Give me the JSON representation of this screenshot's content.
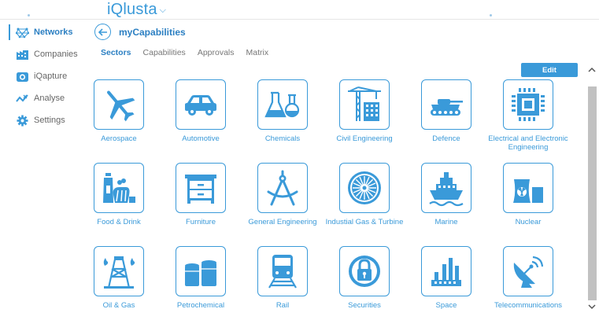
{
  "app": {
    "title": "iQlusta"
  },
  "sidebar": {
    "items": [
      {
        "label": "Networks",
        "icon": "network-icon",
        "active": true
      },
      {
        "label": "Companies",
        "icon": "companies-icon",
        "active": false
      },
      {
        "label": "iQapture",
        "icon": "camera-icon",
        "active": false
      },
      {
        "label": "Analyse",
        "icon": "analyse-icon",
        "active": false
      },
      {
        "label": "Settings",
        "icon": "gear-icon",
        "active": false
      }
    ]
  },
  "page": {
    "title": "myCapabilities",
    "tabs": [
      {
        "label": "Sectors",
        "active": true
      },
      {
        "label": "Capabilities",
        "active": false
      },
      {
        "label": "Approvals",
        "active": false
      },
      {
        "label": "Matrix",
        "active": false
      }
    ],
    "edit_label": "Edit"
  },
  "sectors": [
    {
      "label": "Aerospace",
      "icon": "airplane-icon"
    },
    {
      "label": "Automotive",
      "icon": "car-icon"
    },
    {
      "label": "Chemicals",
      "icon": "flask-icon"
    },
    {
      "label": "Civil Engineering",
      "icon": "crane-icon"
    },
    {
      "label": "Defence",
      "icon": "tank-icon"
    },
    {
      "label": "Electrical and Electronic Engineering",
      "icon": "microchip-icon"
    },
    {
      "label": "Food & Drink",
      "icon": "food-icon"
    },
    {
      "label": "Furniture",
      "icon": "drawers-icon"
    },
    {
      "label": "General Engineering",
      "icon": "compass-icon"
    },
    {
      "label": "Industial Gas & Turbine",
      "icon": "turbine-icon"
    },
    {
      "label": "Marine",
      "icon": "ship-icon"
    },
    {
      "label": "Nuclear",
      "icon": "nuclear-icon"
    },
    {
      "label": "Oil & Gas",
      "icon": "oil-rig-icon"
    },
    {
      "label": "Petrochemical",
      "icon": "tanks-icon"
    },
    {
      "label": "Rail",
      "icon": "train-icon"
    },
    {
      "label": "Securities",
      "icon": "padlock-icon"
    },
    {
      "label": "Space",
      "icon": "factory-icon"
    },
    {
      "label": "Telecommunications",
      "icon": "satellite-dish-icon"
    }
  ],
  "colors": {
    "accent": "#3a9ad9",
    "accent_dark": "#2b7fc2"
  }
}
